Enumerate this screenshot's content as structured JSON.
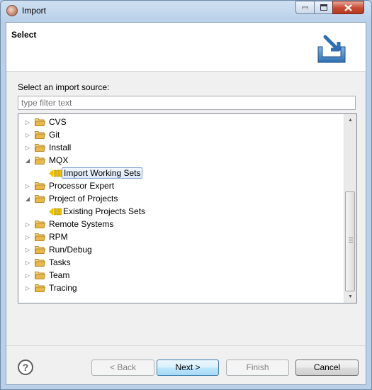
{
  "window": {
    "title": "Import"
  },
  "header": {
    "title": "Select"
  },
  "source_label": "Select an import source:",
  "filter": {
    "placeholder": "type filter text",
    "value": ""
  },
  "tree": [
    {
      "label": "CVS",
      "type": "folder",
      "expanded": false,
      "level": 0
    },
    {
      "label": "Git",
      "type": "folder",
      "expanded": false,
      "level": 0
    },
    {
      "label": "Install",
      "type": "folder",
      "expanded": false,
      "level": 0
    },
    {
      "label": "MQX",
      "type": "folder",
      "expanded": true,
      "level": 0
    },
    {
      "label": "Import Working Sets",
      "type": "item",
      "level": 1,
      "selected": true
    },
    {
      "label": "Processor Expert",
      "type": "folder",
      "expanded": false,
      "level": 0
    },
    {
      "label": "Project of Projects",
      "type": "folder",
      "expanded": true,
      "level": 0
    },
    {
      "label": "Existing Projects Sets",
      "type": "item",
      "level": 1,
      "selected": false
    },
    {
      "label": "Remote Systems",
      "type": "folder",
      "expanded": false,
      "level": 0
    },
    {
      "label": "RPM",
      "type": "folder",
      "expanded": false,
      "level": 0
    },
    {
      "label": "Run/Debug",
      "type": "folder",
      "expanded": false,
      "level": 0
    },
    {
      "label": "Tasks",
      "type": "folder",
      "expanded": false,
      "level": 0
    },
    {
      "label": "Team",
      "type": "folder",
      "expanded": false,
      "level": 0
    },
    {
      "label": "Tracing",
      "type": "folder",
      "expanded": false,
      "level": 0
    }
  ],
  "buttons": {
    "help": "?",
    "back": "< Back",
    "next": "Next >",
    "finish": "Finish",
    "cancel": "Cancel"
  },
  "colors": {
    "folder": "#e8b94a",
    "working_set_icon": "#f2c200",
    "selection": "#dce9f8"
  }
}
